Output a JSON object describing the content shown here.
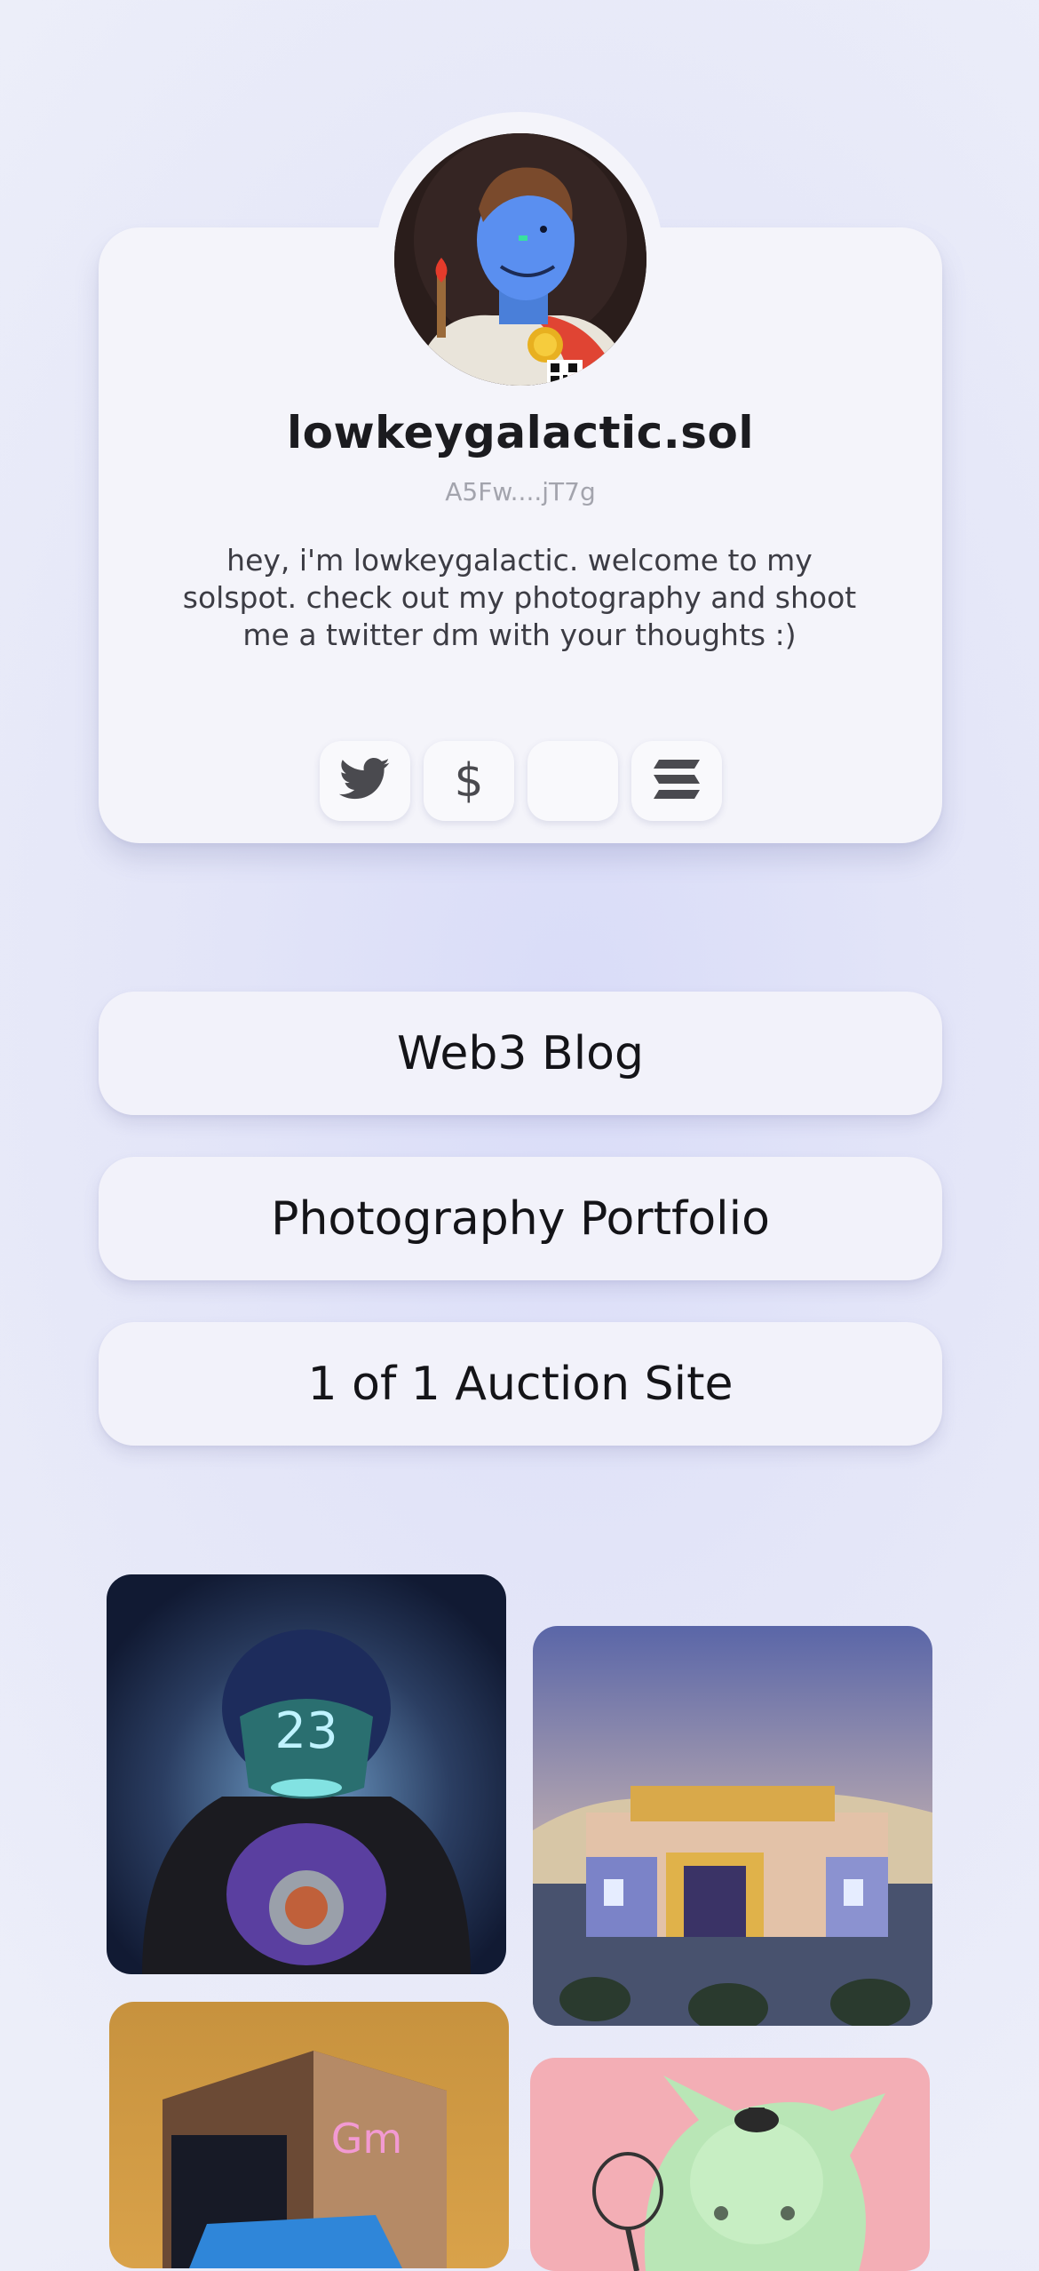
{
  "profile": {
    "name": "lowkeygalactic.sol",
    "wallet": "A5Fw....jT7g",
    "bio": "hey, i'm lowkeygalactic. welcome to my solspot. check out my photography and shoot me a twitter dm with your thoughts :)"
  },
  "socials": [
    {
      "icon": "twitter-icon"
    },
    {
      "icon": "dollar-icon",
      "glyph": "$"
    },
    {
      "icon": "blank-icon"
    },
    {
      "icon": "solana-icon"
    }
  ],
  "links": [
    {
      "label": "Web3 Blog"
    },
    {
      "label": "Photography Portfolio"
    },
    {
      "label": "1 of 1 Auction Site"
    }
  ],
  "gallery": [
    {
      "name": "robot-football-nft",
      "text": "23"
    },
    {
      "name": "desert-house-nft"
    },
    {
      "name": "gm-room-nft",
      "text": "Gm"
    },
    {
      "name": "green-creature-nft"
    }
  ],
  "colors": {
    "card": "#f4f4fa",
    "text": "#1b1b1f",
    "muted": "#a3a4ad",
    "icon": "#4a4a4f"
  }
}
